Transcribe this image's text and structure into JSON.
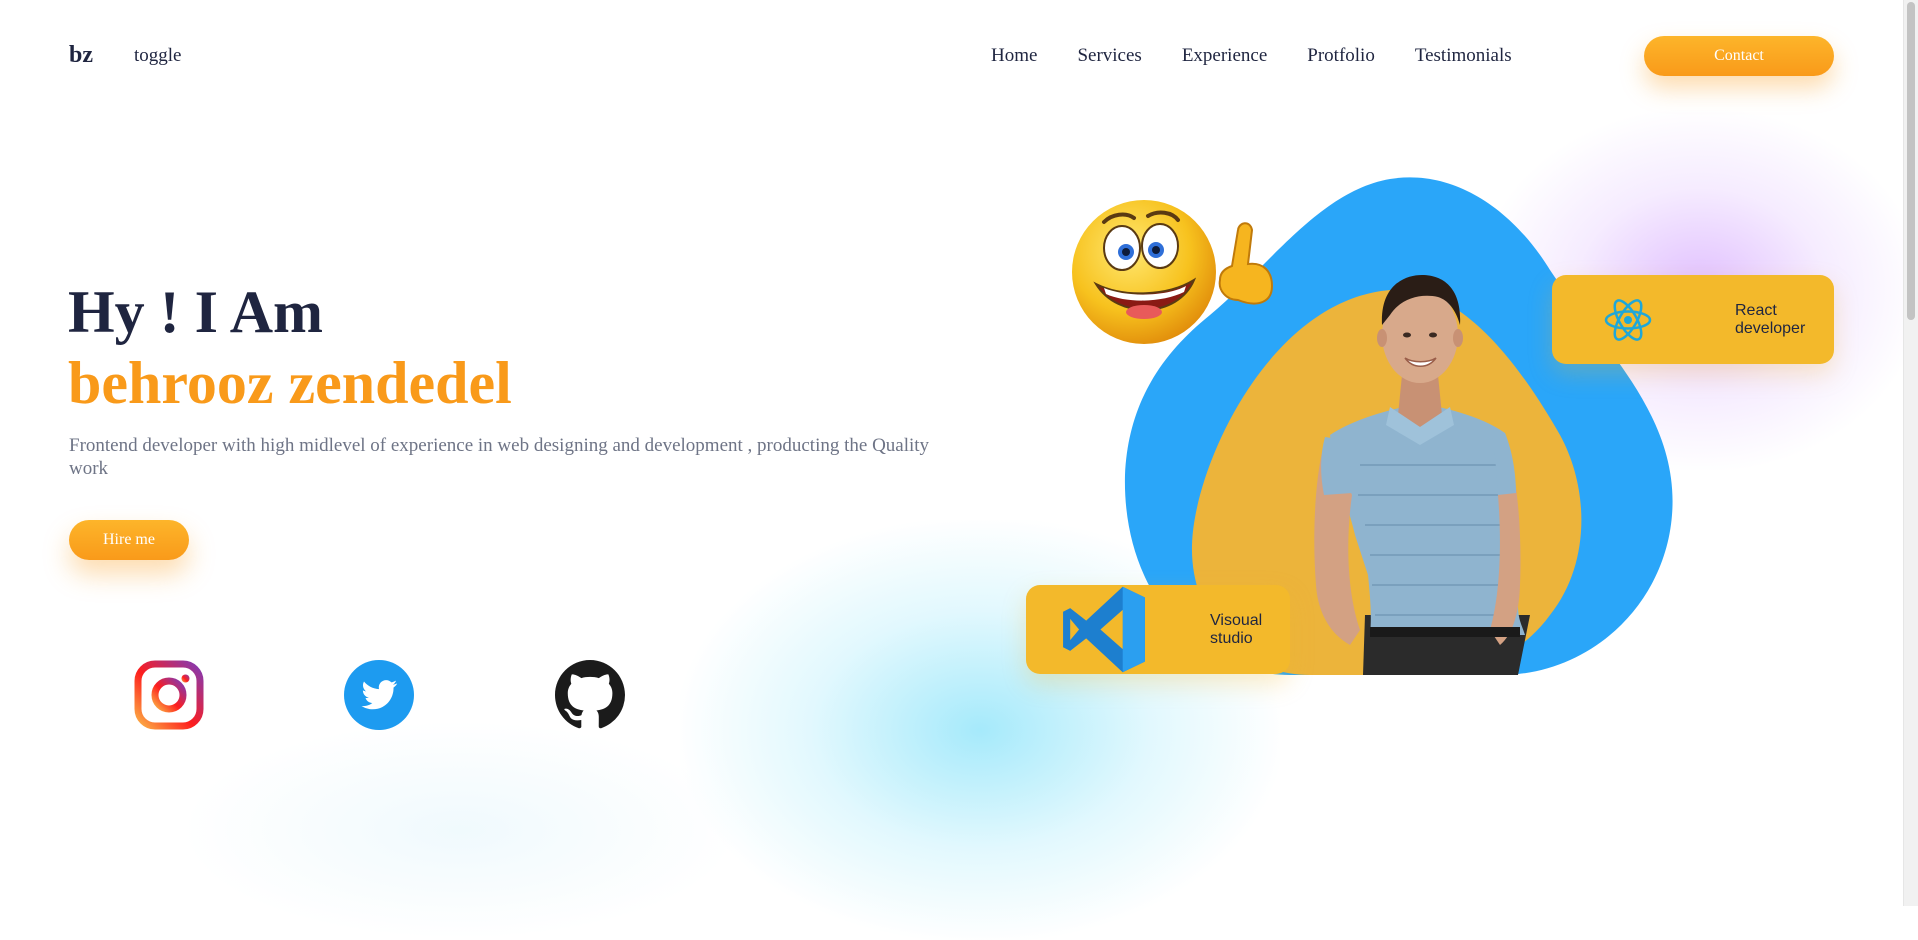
{
  "nav": {
    "logo": "bz",
    "toggle": "toggle",
    "links": [
      "Home",
      "Services",
      "Experience",
      "Protfolio",
      "Testimonials"
    ],
    "contact_label": "Contact"
  },
  "hero": {
    "greeting": "Hy ! I Am",
    "name": "behrooz zendedel",
    "description": "Frontend developer with high midlevel of experience in web designing and development , producting the Quality work",
    "hire_label": "Hire me"
  },
  "social": {
    "icons": [
      "instagram-icon",
      "twitter-icon",
      "github-icon"
    ]
  },
  "cards": {
    "react": "React developer",
    "vscode": "Visoual studio"
  },
  "colors": {
    "accent": "#f99a1a",
    "blob_blue": "#2aa6f9",
    "blob_yellow": "#ecb43b",
    "card": "#f3b92b",
    "heading": "#1f2540"
  }
}
